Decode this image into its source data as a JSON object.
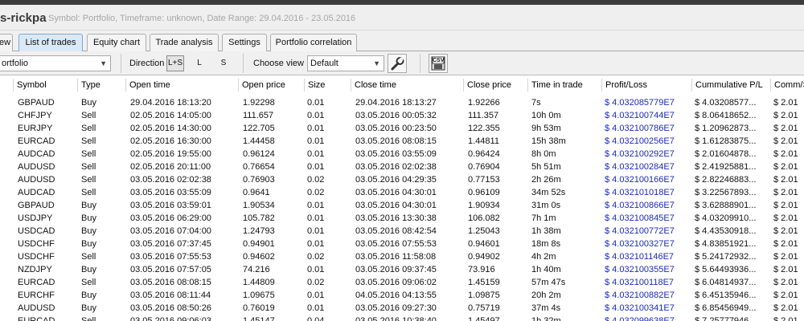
{
  "window": {
    "title": "s-rickpa",
    "subtitle": "Symbol: Portfolio, Timeframe: unknown, Date Range: 29.04.2016 - 23.05.2016"
  },
  "tabs": [
    {
      "label": "ew",
      "active": false
    },
    {
      "label": "List of trades",
      "active": true
    },
    {
      "label": "Equity chart",
      "active": false
    },
    {
      "label": "Trade analysis",
      "active": false
    },
    {
      "label": "Settings",
      "active": false
    },
    {
      "label": "Portfolio correlation",
      "active": false
    }
  ],
  "toolbar": {
    "symbol_select": "ortfolio",
    "direction_label": "Direction",
    "direction_options": [
      "L+S",
      "L",
      "S"
    ],
    "direction_selected": "L+S",
    "choose_view_label": "Choose view",
    "view_select": "Default",
    "tool_icon": "wrench-icon",
    "csv_label": "CSV",
    "csv_icon": "save-csv-icon"
  },
  "colors": {
    "accent_tab": "#dbe9f7",
    "profit_text": "#1b28c4"
  },
  "table": {
    "columns": [
      "Symbol",
      "Type",
      "Open time",
      "Open price",
      "Size",
      "Close time",
      "Close price",
      "Time in trade",
      "Profit/Loss",
      "Cummulative P/L",
      "Comm/S"
    ],
    "rows": [
      [
        "GBPAUD",
        "Buy",
        "29.04.2016 18:13:20",
        "1.92298",
        "0.01",
        "29.04.2016 18:13:27",
        "1.92266",
        "7s",
        "$ 4.032085779E7",
        "$ 4.03208577...",
        "$ 2.01"
      ],
      [
        "CHFJPY",
        "Sell",
        "02.05.2016 14:05:00",
        "111.657",
        "0.01",
        "03.05.2016 00:05:32",
        "111.357",
        "10h 0m",
        "$ 4.032100744E7",
        "$ 8.06418652...",
        "$ 2.01"
      ],
      [
        "EURJPY",
        "Sell",
        "02.05.2016 14:30:00",
        "122.705",
        "0.01",
        "03.05.2016 00:23:50",
        "122.355",
        "9h 53m",
        "$ 4.032100786E7",
        "$ 1.20962873...",
        "$ 2.01"
      ],
      [
        "EURCAD",
        "Sell",
        "02.05.2016 16:30:00",
        "1.44458",
        "0.01",
        "03.05.2016 08:08:15",
        "1.44811",
        "15h 38m",
        "$ 4.032100256E7",
        "$ 1.61283875...",
        "$ 2.01"
      ],
      [
        "AUDCAD",
        "Sell",
        "02.05.2016 19:55:00",
        "0.96124",
        "0.01",
        "03.05.2016 03:55:09",
        "0.96424",
        "8h 0m",
        "$ 4.032100292E7",
        "$ 2.01604878...",
        "$ 2.01"
      ],
      [
        "AUDUSD",
        "Sell",
        "02.05.2016 20:11:00",
        "0.76654",
        "0.01",
        "03.05.2016 02:02:38",
        "0.76904",
        "5h 51m",
        "$ 4.032100284E7",
        "$ 2.41925881...",
        "$ 2.01"
      ],
      [
        "AUDUSD",
        "Sell",
        "03.05.2016 02:02:38",
        "0.76903",
        "0.02",
        "03.05.2016 04:29:35",
        "0.77153",
        "2h 26m",
        "$ 4.032100166E7",
        "$ 2.82246883...",
        "$ 2.01"
      ],
      [
        "AUDCAD",
        "Sell",
        "03.05.2016 03:55:09",
        "0.9641",
        "0.02",
        "03.05.2016 04:30:01",
        "0.96109",
        "34m 52s",
        "$ 4.032101018E7",
        "$ 3.22567893...",
        "$ 2.01"
      ],
      [
        "GBPAUD",
        "Buy",
        "03.05.2016 03:59:01",
        "1.90534",
        "0.01",
        "03.05.2016 04:30:01",
        "1.90934",
        "31m 0s",
        "$ 4.032100866E7",
        "$ 3.62888901...",
        "$ 2.01"
      ],
      [
        "USDJPY",
        "Buy",
        "03.05.2016 06:29:00",
        "105.782",
        "0.01",
        "03.05.2016 13:30:38",
        "106.082",
        "7h 1m",
        "$ 4.032100845E7",
        "$ 4.03209910...",
        "$ 2.01"
      ],
      [
        "USDCAD",
        "Buy",
        "03.05.2016 07:04:00",
        "1.24793",
        "0.01",
        "03.05.2016 08:42:54",
        "1.25043",
        "1h 38m",
        "$ 4.032100772E7",
        "$ 4.43530918...",
        "$ 2.01"
      ],
      [
        "USDCHF",
        "Buy",
        "03.05.2016 07:37:45",
        "0.94901",
        "0.01",
        "03.05.2016 07:55:53",
        "0.94601",
        "18m 8s",
        "$ 4.032100327E7",
        "$ 4.83851921...",
        "$ 2.01"
      ],
      [
        "USDCHF",
        "Sell",
        "03.05.2016 07:55:53",
        "0.94602",
        "0.02",
        "03.05.2016 11:58:08",
        "0.94902",
        "4h 2m",
        "$ 4.032101146E7",
        "$ 5.24172932...",
        "$ 2.01"
      ],
      [
        "NZDJPY",
        "Buy",
        "03.05.2016 07:57:05",
        "74.216",
        "0.01",
        "03.05.2016 09:37:45",
        "73.916",
        "1h 40m",
        "$ 4.032100355E7",
        "$ 5.64493936...",
        "$ 2.01"
      ],
      [
        "EURCAD",
        "Sell",
        "03.05.2016 08:08:15",
        "1.44809",
        "0.02",
        "03.05.2016 09:06:02",
        "1.45159",
        "57m 47s",
        "$ 4.032100118E7",
        "$ 6.04814937...",
        "$ 2.01"
      ],
      [
        "EURCHF",
        "Buy",
        "03.05.2016 08:11:44",
        "1.09675",
        "0.01",
        "04.05.2016 04:13:55",
        "1.09875",
        "20h 2m",
        "$ 4.032100882E7",
        "$ 6.45135946...",
        "$ 2.01"
      ],
      [
        "AUDUSD",
        "Buy",
        "03.05.2016 08:50:26",
        "0.76019",
        "0.01",
        "03.05.2016 09:27:30",
        "0.75719",
        "37m 4s",
        "$ 4.032100341E7",
        "$ 6.85456949...",
        "$ 2.01"
      ],
      [
        "EURCAD",
        "Sell",
        "03.05.2016 09:06:03",
        "1.45147",
        "0.04",
        "03.05.2016 10:38:40",
        "1.45497",
        "1h 32m",
        "$ 4.032099638E7",
        "$ 7.25777946...",
        "$ 2.01"
      ]
    ]
  }
}
